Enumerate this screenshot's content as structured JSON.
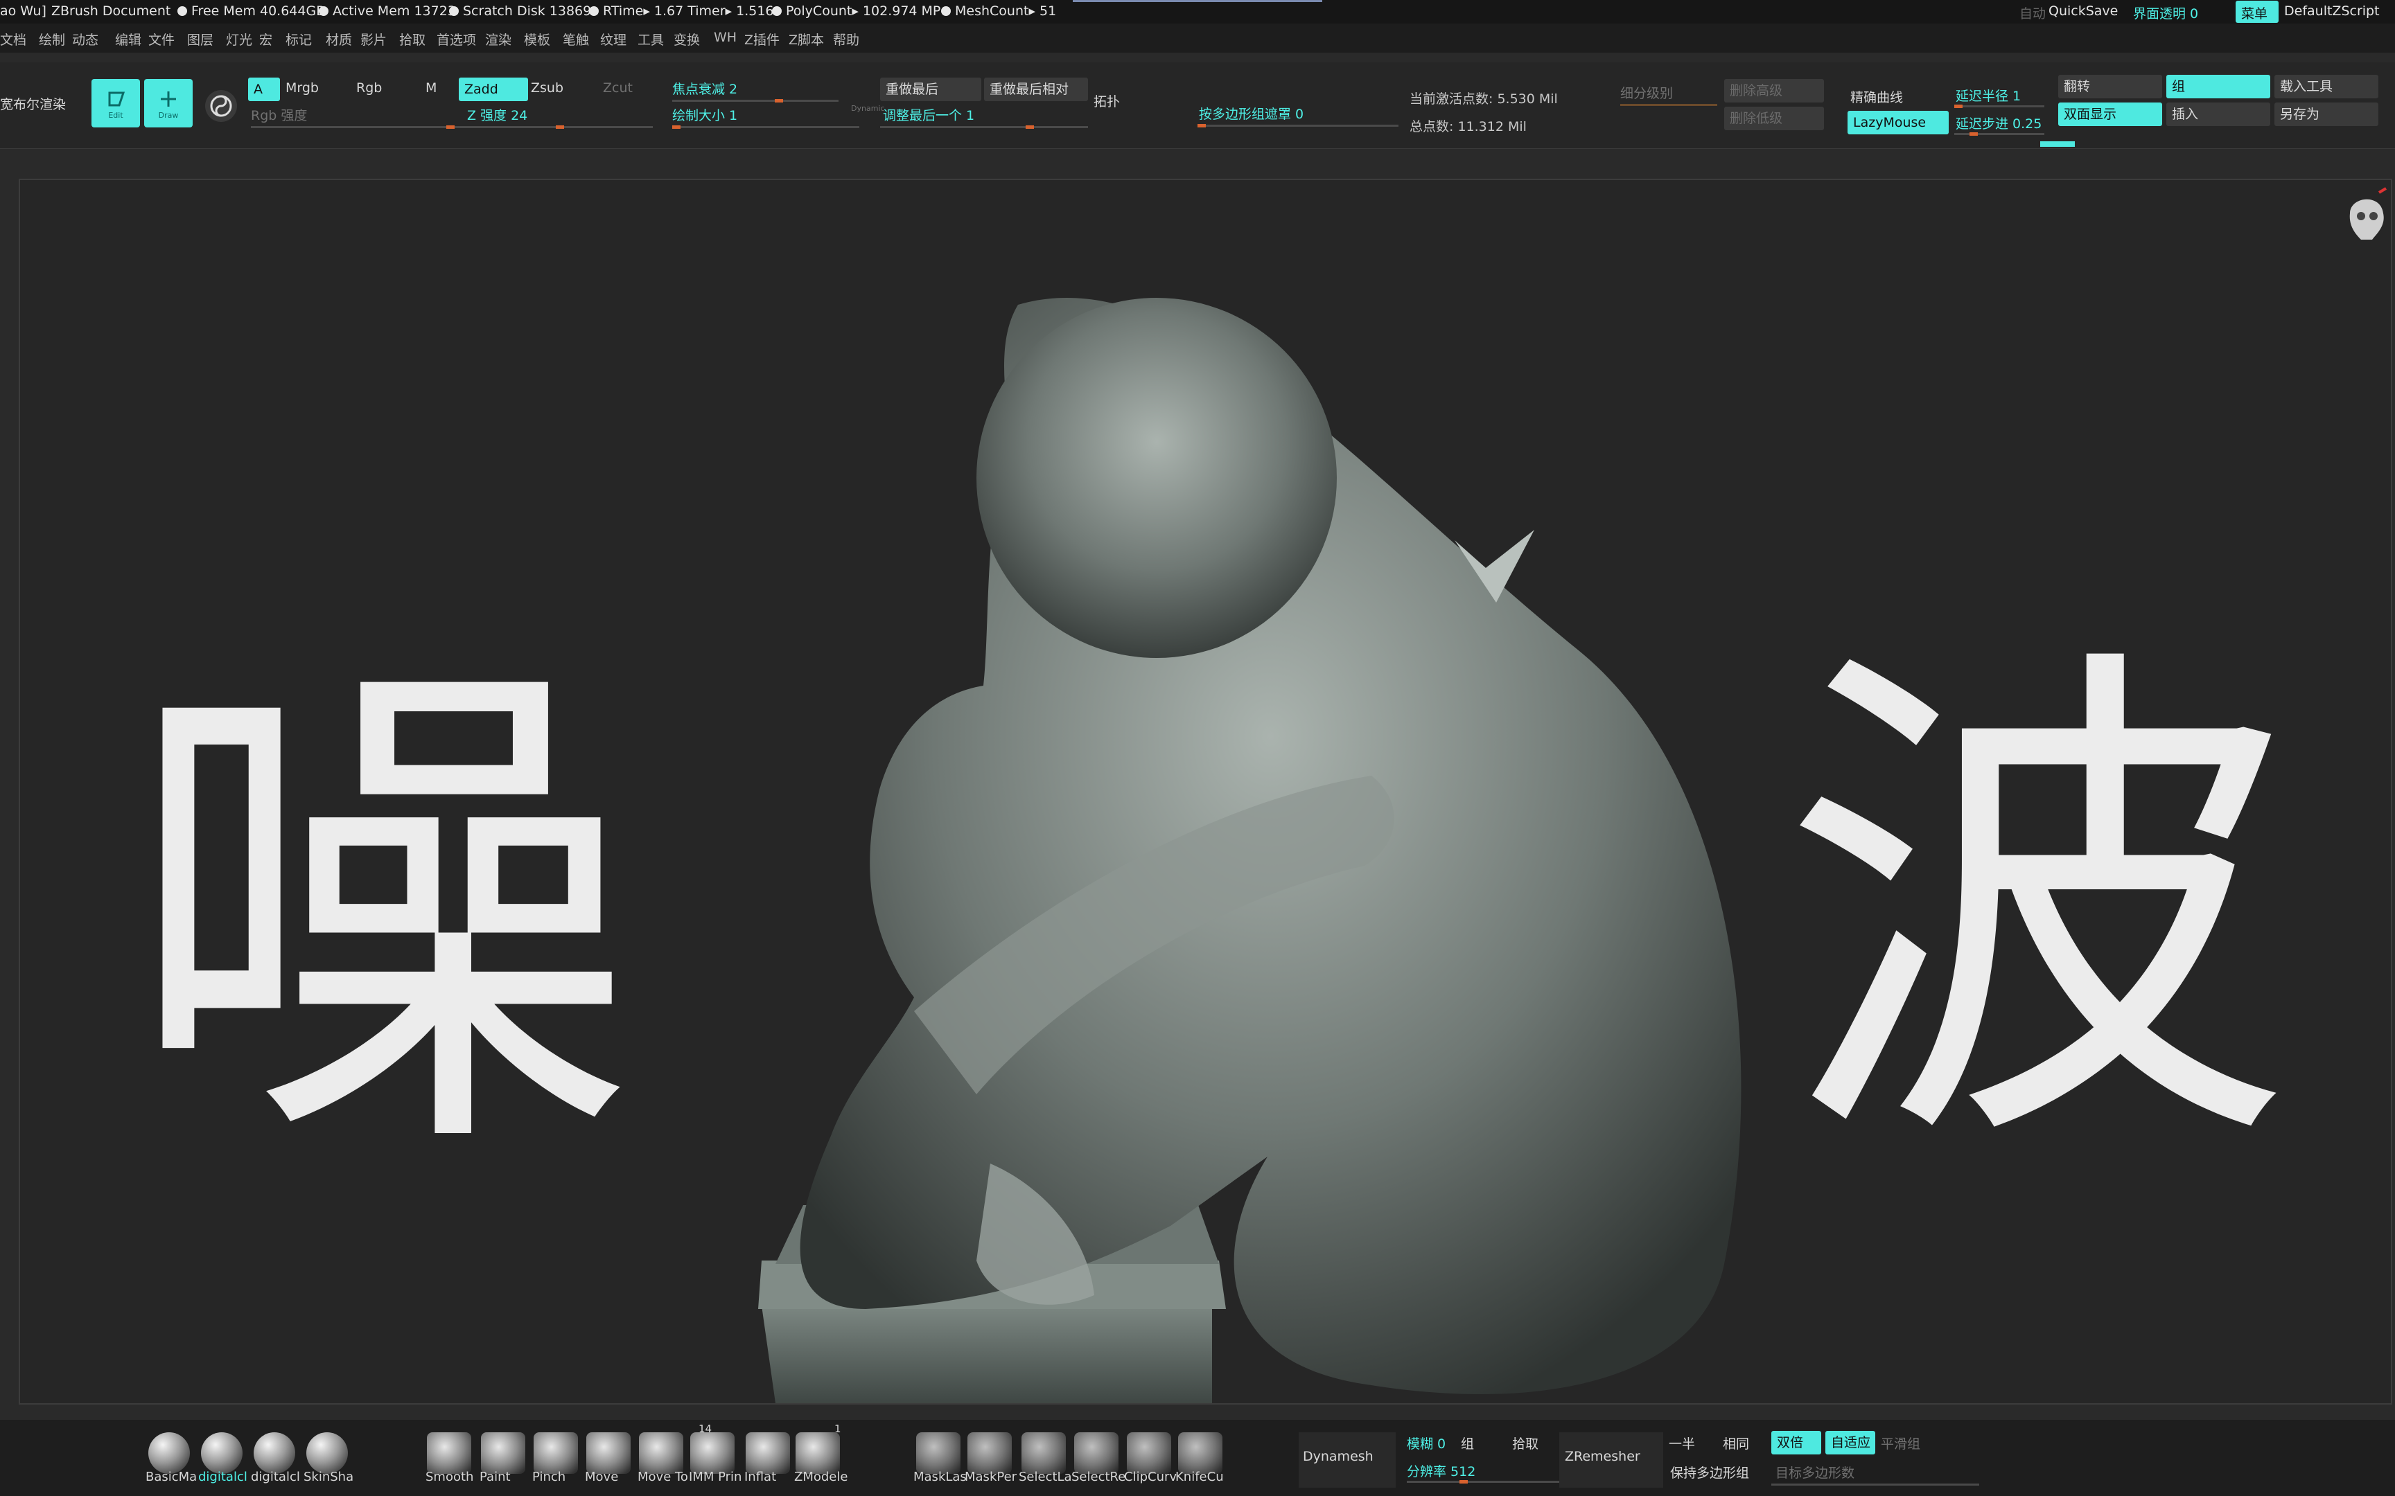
{
  "titlebar": {
    "user": "ao Wu]",
    "document": "ZBrush Document",
    "free_mem": "Free Mem 40.644GB",
    "active_mem": "Active Mem 13723",
    "scratch_disk": "Scratch Disk 13869",
    "rtime": "RTime▸ 1.67 Timer▸ 1.516",
    "polycount": "PolyCount▸ 102.974 MP",
    "meshcount": "MeshCount▸ 51",
    "auto": "自动",
    "quicksave": "QuickSave",
    "ui_transparency": "界面透明 0",
    "menu": "菜单",
    "zscript": "DefaultZScript"
  },
  "menubar": {
    "items": [
      "文档",
      "绘制",
      "动态",
      "编辑",
      "文件",
      "图层",
      "灯光",
      "宏",
      "标记",
      "材质",
      "影片",
      "拾取",
      "首选项",
      "渲染",
      "模板",
      "笔触",
      "纹理",
      "工具",
      "变换",
      "WH",
      "Z插件",
      "Z脚本",
      "帮助"
    ]
  },
  "shelf": {
    "bpr": "宽布尔渲染",
    "edit_label": "Edit",
    "draw_label": "Draw",
    "a": "A",
    "mrgb": "Mrgb",
    "rgb": "Rgb",
    "m": "M",
    "rgb_intensity": "Rgb 强度",
    "zadd": "Zadd",
    "zsub": "Zsub",
    "zcut": "Zcut",
    "z_intensity": "Z 强度 24",
    "focal_shift": "焦点衰减 2",
    "draw_size": "绘制大小 1",
    "dynamic": "Dynamic",
    "redo_last": "重做最后",
    "redo_last_rel": "重做最后相对",
    "adjust_last": "调整最后一个 1",
    "topology": "拓扑",
    "polygroup_mask": "按多边形组遮罩 0",
    "active_points": "当前激活点数: 5.530 Mil",
    "total_points": "总点数: 11.312 Mil",
    "subdiv_level": "细分级别",
    "del_higher": "删除高级",
    "del_lower": "删除低级",
    "precise_curve": "精确曲线",
    "lazymouse": "LazyMouse",
    "lazy_radius": "延迟半径 1",
    "lazy_step": "延迟步进 0.25",
    "flip": "翻转",
    "double_sided": "双面显示",
    "group": "组",
    "insert": "插入",
    "load_tool": "载入工具",
    "save_as": "另存为"
  },
  "canvas": {
    "left_char": "噪",
    "right_char": "波"
  },
  "bottom": {
    "materials": [
      "BasicMa",
      "digitalcl",
      "digitalcl",
      "SkinSha"
    ],
    "brushes": [
      "Smooth",
      "Paint",
      "Pinch",
      "Move",
      "Move To",
      "IMM Prin",
      "Inflat",
      "ZModele"
    ],
    "imm_count": "14",
    "zmodeler_count": "1",
    "mask_tools": [
      "MaskLas",
      "MaskPer",
      "SelectLa",
      "SelectRe",
      "ClipCurv",
      "KnifeCu"
    ],
    "dynamesh": "Dynamesh",
    "blur": "模糊 0",
    "group_label": "组",
    "pick": "拾取",
    "resolution": "分辨率 512",
    "zremesher": "ZRemesher",
    "half": "一半",
    "same": "相同",
    "double": "双倍",
    "adaptive": "自适应",
    "smooth_groups": "平滑组",
    "keep_groups": "保持多边形组",
    "target_poly": "目标多边形数"
  }
}
